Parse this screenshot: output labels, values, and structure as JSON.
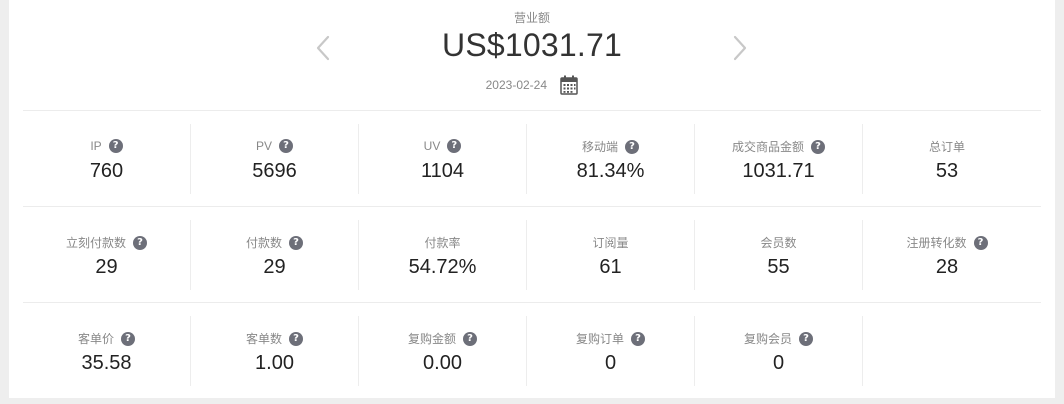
{
  "revenue": {
    "label": "营业额",
    "amount": "US$1031.71",
    "date": "2023-02-24",
    "prev_icon": "chevron-left-icon",
    "next_icon": "chevron-right-icon",
    "calendar_icon": "calendar-icon"
  },
  "help_glyph": "?",
  "rows": [
    [
      {
        "label": "IP",
        "value": "760",
        "help": true
      },
      {
        "label": "PV",
        "value": "5696",
        "help": true
      },
      {
        "label": "UV",
        "value": "1104",
        "help": true
      },
      {
        "label": "移动端",
        "value": "81.34%",
        "help": true
      },
      {
        "label": "成交商品金额",
        "value": "1031.71",
        "help": true
      },
      {
        "label": "总订单",
        "value": "53",
        "help": false
      }
    ],
    [
      {
        "label": "立刻付款数",
        "value": "29",
        "help": true
      },
      {
        "label": "付款数",
        "value": "29",
        "help": true
      },
      {
        "label": "付款率",
        "value": "54.72%",
        "help": false
      },
      {
        "label": "订阅量",
        "value": "61",
        "help": false
      },
      {
        "label": "会员数",
        "value": "55",
        "help": false
      },
      {
        "label": "注册转化数",
        "value": "28",
        "help": true
      }
    ],
    [
      {
        "label": "客单价",
        "value": "35.58",
        "help": true
      },
      {
        "label": "客单数",
        "value": "1.00",
        "help": true
      },
      {
        "label": "复购金额",
        "value": "0.00",
        "help": true
      },
      {
        "label": "复购订单",
        "value": "0",
        "help": true
      },
      {
        "label": "复购会员",
        "value": "0",
        "help": true
      }
    ]
  ]
}
